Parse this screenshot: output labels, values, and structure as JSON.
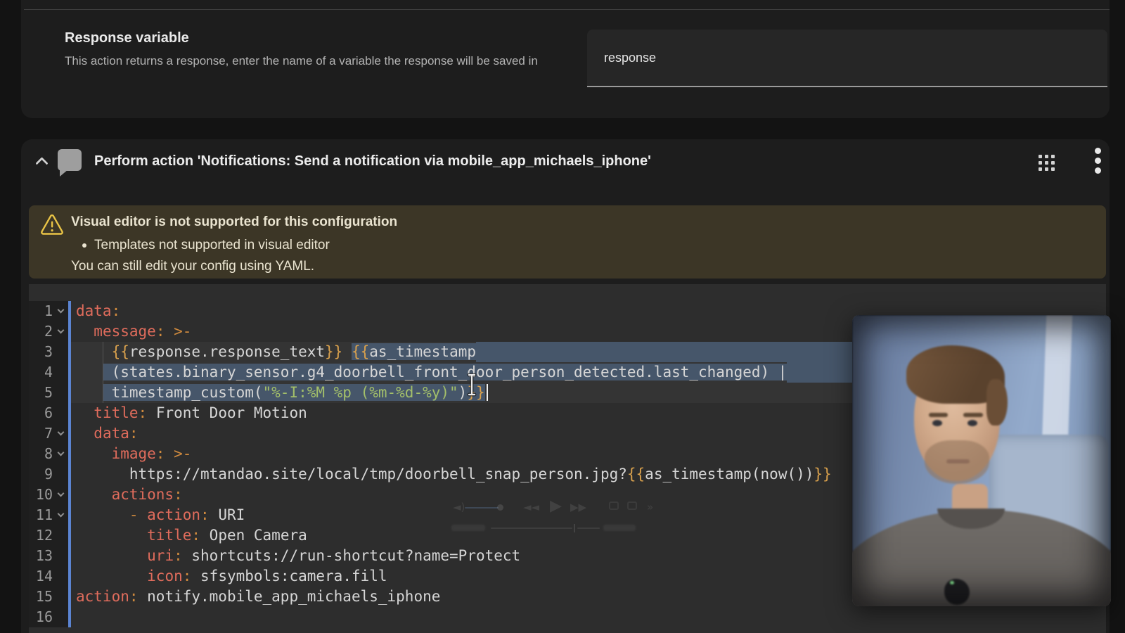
{
  "colors": {
    "page_bg": "#131313",
    "card_bg": "#1d1d1d",
    "divider": "#3d3d3d",
    "input_bg": "#262626",
    "input_underline": "#9a9a9a",
    "warning_bg": "#3c3626",
    "warning_icon": "#e9c446",
    "warning_text": "#eae4d0",
    "editor_bg": "#2d2d2d",
    "gutter_bg": "#1f1f1f",
    "gutter_text": "#9a9a9a",
    "focus_bar": "#5b84d2",
    "active_line_bg": "#343434",
    "selection_bg": "#46566a",
    "tok_key": "#e06c5c",
    "tok_punct": "#cf8a3e",
    "tok_brace": "#d9a14d",
    "tok_text": "#d6d6d6",
    "tok_str": "#a3bf6a"
  },
  "response_section": {
    "title": "Response variable",
    "description": "This action returns a response, enter the name of a variable the response will be saved in",
    "input_value": "response"
  },
  "action_card": {
    "title": "Perform action 'Notifications: Send a notification via mobile_app_michaels_iphone'"
  },
  "warning": {
    "title": "Visual editor is not supported for this configuration",
    "bullet": "Templates not supported in visual editor",
    "footer": "You can still edit your config using YAML."
  },
  "editor": {
    "lines": [
      {
        "n": 1,
        "fold": true,
        "tokens": [
          {
            "c": "key",
            "s": "data"
          },
          {
            "c": "punct",
            "s": ":"
          }
        ]
      },
      {
        "n": 2,
        "fold": true,
        "tokens": [
          {
            "c": "text",
            "s": "  "
          },
          {
            "c": "key",
            "s": "message"
          },
          {
            "c": "punct",
            "s": ":"
          },
          {
            "c": "text",
            "s": " "
          },
          {
            "c": "punct",
            "s": ">-"
          }
        ]
      },
      {
        "n": 3,
        "active": true,
        "guide": true,
        "fillRight": true,
        "tokens": [
          {
            "c": "text",
            "s": "    "
          },
          {
            "c": "brace",
            "s": "{{"
          },
          {
            "c": "text",
            "s": "response.response_text"
          },
          {
            "c": "brace",
            "s": "}}"
          },
          {
            "c": "text",
            "s": " "
          },
          {
            "c": "brace",
            "s": "{{",
            "sel": true
          },
          {
            "c": "text",
            "s": "as_timestamp",
            "sel": true
          }
        ]
      },
      {
        "n": 4,
        "active": true,
        "guide": true,
        "fillRight": true,
        "tokens": [
          {
            "c": "text",
            "s": "   "
          },
          {
            "c": "text",
            "s": " (states.binary_sensor.g4_doorbell_front_door_person_detected.last_changed) |",
            "sel": true
          }
        ]
      },
      {
        "n": 5,
        "active": true,
        "guide": true,
        "cursor": true,
        "tokens": [
          {
            "c": "text",
            "s": "   "
          },
          {
            "c": "text",
            "s": " timestamp_custom(",
            "sel": true
          },
          {
            "c": "str",
            "s": "\"%-I:%M %p (%m-%d-%y)\"",
            "sel": true
          },
          {
            "c": "text",
            "s": ")",
            "sel": true
          },
          {
            "c": "brace",
            "s": "}}",
            "sel": true
          }
        ]
      },
      {
        "n": 6,
        "tokens": [
          {
            "c": "text",
            "s": "  "
          },
          {
            "c": "key",
            "s": "title"
          },
          {
            "c": "punct",
            "s": ":"
          },
          {
            "c": "text",
            "s": " Front Door Motion"
          }
        ]
      },
      {
        "n": 7,
        "fold": true,
        "tokens": [
          {
            "c": "text",
            "s": "  "
          },
          {
            "c": "key",
            "s": "data"
          },
          {
            "c": "punct",
            "s": ":"
          }
        ]
      },
      {
        "n": 8,
        "fold": true,
        "tokens": [
          {
            "c": "text",
            "s": "    "
          },
          {
            "c": "key",
            "s": "image"
          },
          {
            "c": "punct",
            "s": ":"
          },
          {
            "c": "text",
            "s": " "
          },
          {
            "c": "punct",
            "s": ">-"
          }
        ]
      },
      {
        "n": 9,
        "tokens": [
          {
            "c": "text",
            "s": "      https://mtandao.site/local/tmp/doorbell_snap_person.jpg?"
          },
          {
            "c": "brace",
            "s": "{{"
          },
          {
            "c": "text",
            "s": "as_timestamp(now())"
          },
          {
            "c": "brace",
            "s": "}}"
          }
        ]
      },
      {
        "n": 10,
        "fold": true,
        "tokens": [
          {
            "c": "text",
            "s": "    "
          },
          {
            "c": "key",
            "s": "actions"
          },
          {
            "c": "punct",
            "s": ":"
          }
        ]
      },
      {
        "n": 11,
        "fold": true,
        "tokens": [
          {
            "c": "text",
            "s": "      "
          },
          {
            "c": "punct",
            "s": "- "
          },
          {
            "c": "key",
            "s": "action"
          },
          {
            "c": "punct",
            "s": ":"
          },
          {
            "c": "text",
            "s": " URI"
          }
        ]
      },
      {
        "n": 12,
        "tokens": [
          {
            "c": "text",
            "s": "        "
          },
          {
            "c": "key",
            "s": "title"
          },
          {
            "c": "punct",
            "s": ":"
          },
          {
            "c": "text",
            "s": " Open Camera"
          }
        ]
      },
      {
        "n": 13,
        "tokens": [
          {
            "c": "text",
            "s": "        "
          },
          {
            "c": "key",
            "s": "uri"
          },
          {
            "c": "punct",
            "s": ":"
          },
          {
            "c": "text",
            "s": " shortcuts://run-shortcut?name=Protect"
          }
        ]
      },
      {
        "n": 14,
        "tokens": [
          {
            "c": "text",
            "s": "        "
          },
          {
            "c": "key",
            "s": "icon"
          },
          {
            "c": "punct",
            "s": ":"
          },
          {
            "c": "text",
            "s": " sfsymbols:camera.fill"
          }
        ]
      },
      {
        "n": 15,
        "tokens": [
          {
            "c": "key",
            "s": "action"
          },
          {
            "c": "punct",
            "s": ":"
          },
          {
            "c": "text",
            "s": " notify.mobile_app_michaels_iphone"
          }
        ]
      },
      {
        "n": 16,
        "tokens": []
      }
    ]
  }
}
